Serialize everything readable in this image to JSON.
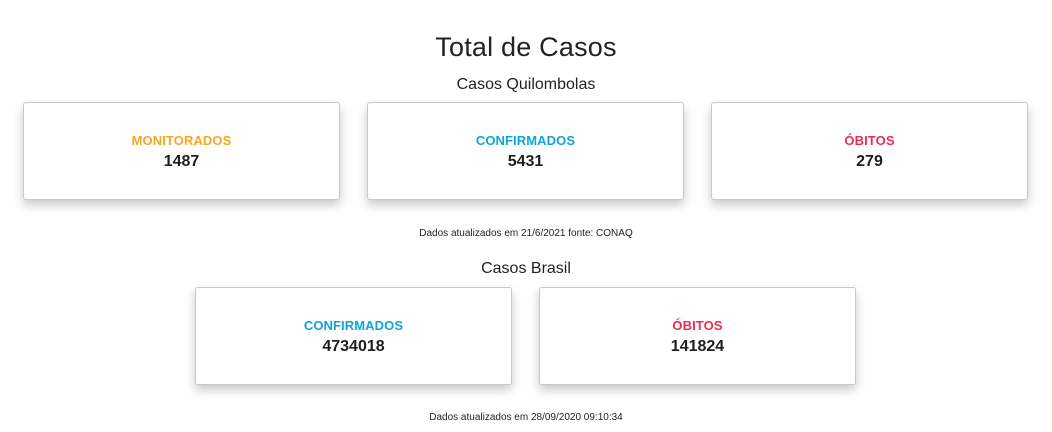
{
  "title": "Total de Casos",
  "quilombolas": {
    "heading": "Casos Quilombolas",
    "cards": [
      {
        "label": "MONITORADOS",
        "value": "1487",
        "color": "#f5a623"
      },
      {
        "label": "CONFIRMADOS",
        "value": "5431",
        "color": "#10a5d8"
      },
      {
        "label": "ÓBITOS",
        "value": "279",
        "color": "#ef2b55"
      }
    ],
    "footnote": "Dados atualizados em 21/6/2021 fonte: CONAQ"
  },
  "brasil": {
    "heading": "Casos Brasil",
    "cards": [
      {
        "label": "CONFIRMADOS",
        "value": "4734018",
        "color": "#10a5d8"
      },
      {
        "label": "ÓBITOS",
        "value": "141824",
        "color": "#ef2b55"
      }
    ],
    "footnote": "Dados atualizados em 28/09/2020 09:10:34"
  }
}
